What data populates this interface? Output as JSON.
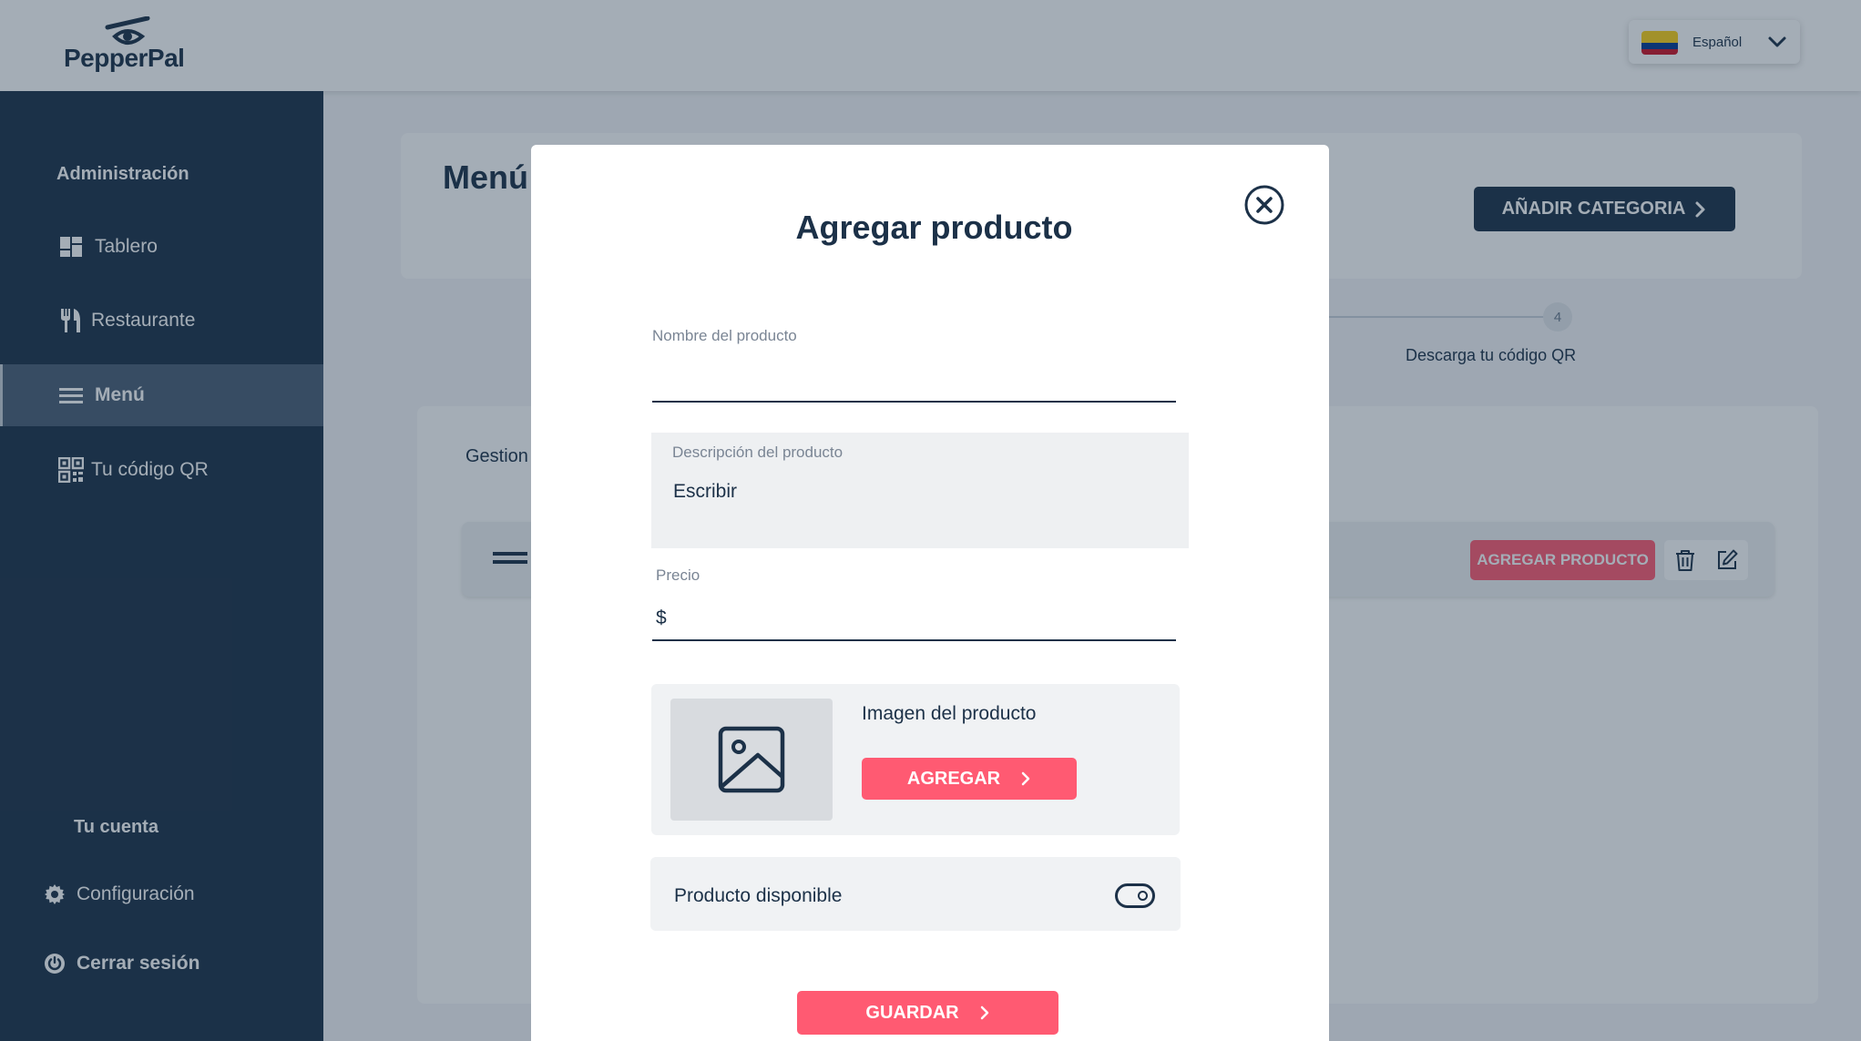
{
  "app": {
    "logo_text": "PepperPal"
  },
  "language": {
    "label": "Español",
    "flag_colors": [
      "#FCD116",
      "#003893",
      "#CE1126"
    ]
  },
  "sidebar": {
    "admin_heading": "Administración",
    "items": [
      {
        "label": "Tablero",
        "icon": "dashboard-icon"
      },
      {
        "label": "Restaurante",
        "icon": "utensils-icon"
      },
      {
        "label": "Menú",
        "icon": "menu-lines-icon",
        "active": true
      },
      {
        "label": "Tu código QR",
        "icon": "qr-code-icon"
      }
    ],
    "account_heading": "Tu cuenta",
    "settings_label": "Configuración",
    "logout_label": "Cerrar sesión"
  },
  "main": {
    "title": "Menú",
    "add_category_label": "AÑADIR CATEGORIA",
    "step_number": "4",
    "step_label": "Descarga tu código QR",
    "manage_label": "Gestion",
    "add_product_label": "AGREGAR PRODUCTO"
  },
  "modal": {
    "title": "Agregar producto",
    "name_label": "Nombre del producto",
    "name_value": "",
    "description_label": "Descripción del producto",
    "description_value": "Escribir",
    "price_label": "Precio",
    "price_prefix": "$",
    "price_value": "",
    "image_label": "Imagen del producto",
    "add_image_label": "AGREGAR",
    "available_label": "Producto disponible",
    "available": true,
    "save_label": "GUARDAR"
  },
  "colors": {
    "navy": "#1c3148",
    "accent_pink": "#ff5a72"
  }
}
